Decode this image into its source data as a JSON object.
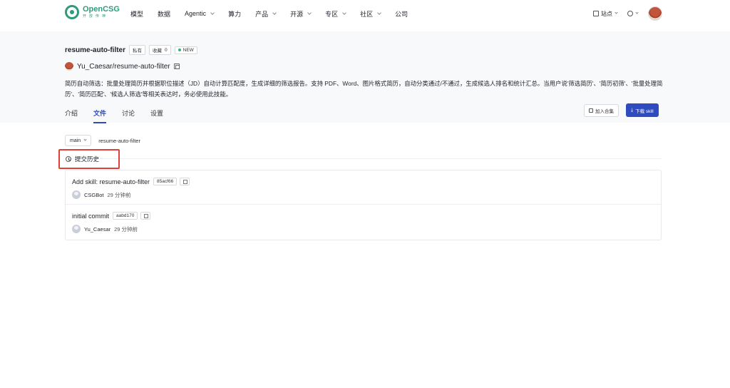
{
  "nav": {
    "brand_name": "OpenCSG",
    "brand_sub": "开放传神",
    "items": [
      {
        "label": "模型",
        "has_dropdown": false
      },
      {
        "label": "数据",
        "has_dropdown": false
      },
      {
        "label": "Agentic",
        "has_dropdown": true
      },
      {
        "label": "算力",
        "has_dropdown": false
      },
      {
        "label": "产品",
        "has_dropdown": true
      },
      {
        "label": "开源",
        "has_dropdown": true
      },
      {
        "label": "专区",
        "has_dropdown": true
      },
      {
        "label": "社区",
        "has_dropdown": true
      },
      {
        "label": "公司",
        "has_dropdown": false
      }
    ],
    "site_label": "站点",
    "site_icon": "site-switch-icon",
    "lang_icon": "globe-icon"
  },
  "repo": {
    "name": "resume-auto-filter",
    "visibility": "私有",
    "favorite_label": "收藏",
    "favorite_count": "0",
    "new_badge": "NEW",
    "owner": "Yu_Caesar",
    "separator": "/",
    "path_name": "resume-auto-filter",
    "description": "简历自动筛选：批量处理简历并根据职位描述（JD）自动计算匹配度，生成详细的筛选报告。支持 PDF、Word、图片格式简历，自动分类通过/不通过，生成候选人排名和统计汇总。当用户说'筛选简历'、'简历初筛'、'批量处理简历'、'简历匹配'、'候选人筛选'等相关表达时，务必使用此技能。"
  },
  "tabs": [
    {
      "label": "介绍",
      "active": false
    },
    {
      "label": "文件",
      "active": true
    },
    {
      "label": "讨论",
      "active": false
    },
    {
      "label": "设置",
      "active": false
    }
  ],
  "actions": {
    "add_collection": "加入合集",
    "download": "下载 skill"
  },
  "files": {
    "branch": "main",
    "breadcrumb": "resume-auto-filter",
    "history_label": "提交历史"
  },
  "commits": [
    {
      "message": "Add skill: resume-auto-filter",
      "sha": "85acf66",
      "user": "CSGBot",
      "time": "29 分钟前"
    },
    {
      "message": "initial commit",
      "sha": "aabd170",
      "user": "Yu_Caesar",
      "time": "29 分钟前"
    }
  ],
  "colors": {
    "brand": "#2f9b7c",
    "accent": "#2e4cbf",
    "highlight": "#e0403a"
  }
}
